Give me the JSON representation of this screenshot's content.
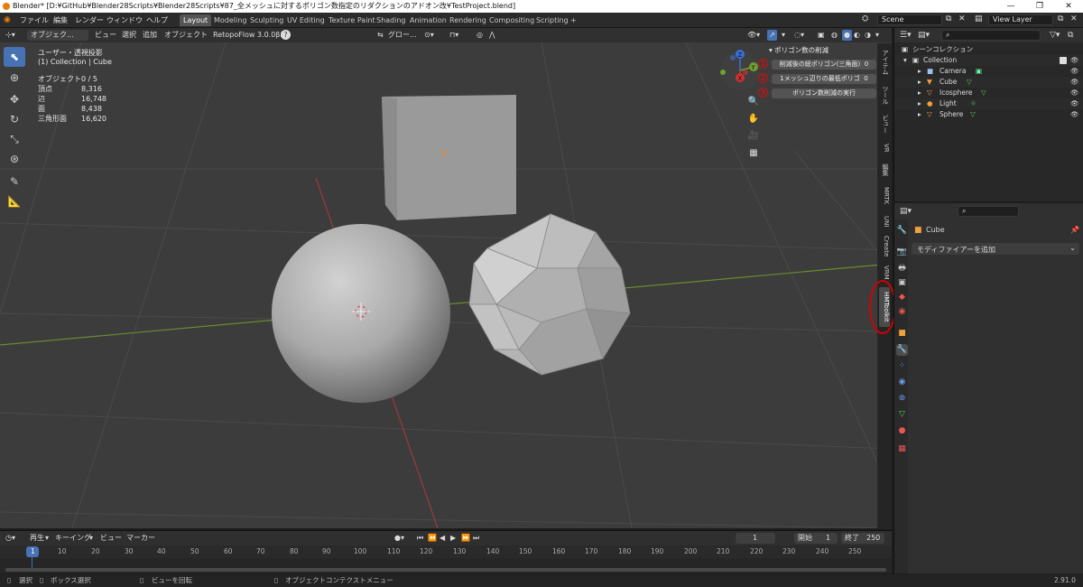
{
  "window": {
    "title": "Blender* [D:¥GitHub¥Blender28Scripts¥Blender28Scripts¥87_全メッシュに対するポリゴン数指定のリダクションのアドオン改¥TestProject.blend]",
    "buttons": [
      "—",
      "❐",
      "✕"
    ]
  },
  "menus": [
    "ファイル",
    "編集",
    "レンダー",
    "ウィンドウ",
    "ヘルプ"
  ],
  "workspaces": [
    "Layout",
    "Modeling",
    "Sculpting",
    "UV Editing",
    "Texture Paint",
    "Shading",
    "Animation",
    "Rendering",
    "Compositing",
    "Scripting",
    "+"
  ],
  "scene": "Scene",
  "view_layer": "View Layer",
  "viewport_header": {
    "mode": "オブジェク...",
    "menus": [
      "ビュー",
      "選択",
      "追加",
      "オブジェクト"
    ],
    "addon": "RetopoFlow 3.0.0β2",
    "transform": "グロー...",
    "help": "?"
  },
  "viewport": {
    "view_name": "ユーザー・透視投影",
    "collection": "(1) Collection | Cube"
  },
  "stats": [
    {
      "label": "オブジェクト",
      "value": "0 / 5"
    },
    {
      "label": "頂点",
      "value": "8,316"
    },
    {
      "label": "辺",
      "value": "16,748"
    },
    {
      "label": "面",
      "value": "8,438"
    },
    {
      "label": "三角形面",
      "value": "16,620"
    }
  ],
  "npanel": {
    "title": "ポリゴン数の削減",
    "items": [
      {
        "num": "1",
        "label": "削減後の総ポリゴン(三角面)",
        "value": "0"
      },
      {
        "num": "2",
        "label": "1メッシュ辺りの最低ポリゴ",
        "value": "0"
      },
      {
        "num": "3",
        "label": "ポリゴン数削減の実行",
        "value": ""
      }
    ]
  },
  "gizmo": {
    "z": "Z",
    "y": "Y",
    "x": "X"
  },
  "side_tabs": [
    "アイテム",
    "ツール",
    "ビュー",
    "VR",
    "編集",
    "MRTK",
    "UNI",
    "Create",
    "VRM",
    "HMToolkit"
  ],
  "outliner": {
    "root": "シーンコレクション",
    "collection": "Collection",
    "items": [
      "Camera",
      "Cube",
      "Icosphere",
      "Light",
      "Sphere"
    ]
  },
  "properties": {
    "object": "Cube",
    "add_modifier": "モディファイアーを追加"
  },
  "timeline": {
    "menus": [
      "再生",
      "キーイング",
      "ビュー",
      "マーカー"
    ],
    "current_frame": "1",
    "start_label": "開始",
    "start": "1",
    "end_label": "終了",
    "end": "250",
    "ticks": [
      "1",
      "10",
      "20",
      "30",
      "40",
      "50",
      "60",
      "70",
      "80",
      "90",
      "100",
      "110",
      "120",
      "130",
      "140",
      "150",
      "160",
      "170",
      "180",
      "190",
      "200",
      "210",
      "220",
      "230",
      "240",
      "250"
    ]
  },
  "status": {
    "select": "選択",
    "box": "ボックス選択",
    "rotate": "ビューを回転",
    "context": "オブジェクトコンテクストメニュー",
    "version": "2.91.0"
  },
  "colors": {
    "accent": "#4772b3",
    "highlight": "#d40000",
    "background": "#3c3c3c"
  }
}
